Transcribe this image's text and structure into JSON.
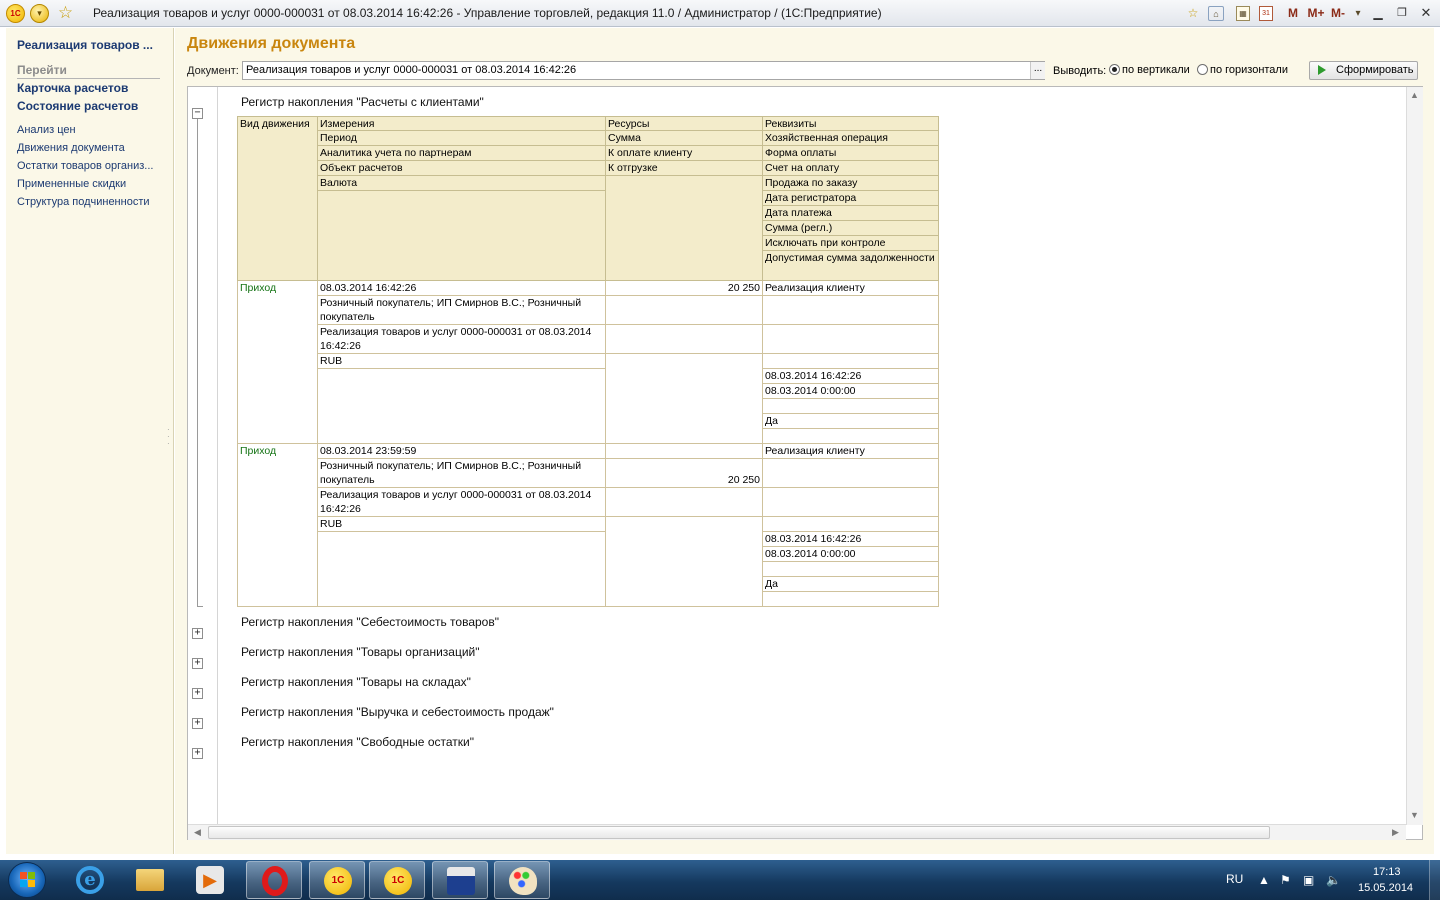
{
  "window": {
    "title": "Реализация товаров и услуг 0000-000031 от 08.03.2014 16:42:26 - Управление торговлей, редакция 11.0 / Администратор /  (1С:Предприятие)",
    "logo": "1С",
    "m_labels": [
      "M",
      "M+",
      "M-"
    ]
  },
  "sidebar": {
    "title": "Реализация товаров ...",
    "goto_label": "Перейти",
    "primary_links": [
      "Карточка расчетов",
      "Состояние расчетов"
    ],
    "links": [
      "Анализ цен",
      "Движения документа",
      "Остатки товаров организ...",
      "Примененные скидки",
      "Структура подчиненности"
    ]
  },
  "main": {
    "title": "Движения документа",
    "document_label": "Документ:",
    "document_value": "Реализация товаров и услуг 0000-000031 от 08.03.2014 16:42:26",
    "document_select": "...",
    "output_label": "Выводить:",
    "output_options": [
      {
        "label": "по вертикали",
        "selected": true
      },
      {
        "label": "по горизонтали",
        "selected": false
      }
    ],
    "run_button": "Сформировать"
  },
  "report": {
    "expanded_register": "Регистр накопления \"Расчеты с клиентами\"",
    "table": {
      "col_kind": "Вид движения",
      "col_dims": "Измерения",
      "col_res": "Ресурсы",
      "col_props": "Реквизиты",
      "dims": [
        "Период",
        "Аналитика учета по партнерам",
        "Объект расчетов",
        "Валюта"
      ],
      "res": [
        "Сумма",
        "К оплате клиенту",
        "К отгрузке"
      ],
      "props": [
        "Хозяйственная операция",
        "Форма оплаты",
        "Счет на оплату",
        "Продажа по заказу",
        "Дата регистратора",
        "Дата платежа",
        "Сумма (регл.)",
        "Исключать при контроле",
        "Допустимая сумма задолженности"
      ]
    },
    "records": [
      {
        "kind": "Приход",
        "period": "08.03.2014 16:42:26",
        "partner": "Розничный покупатель; ИП Смирнов В.С.; Розничный покупатель",
        "object": "Реализация товаров и услуг 0000-000031 от 08.03.2014 16:42:26",
        "currency": "RUB",
        "amount": "20 250",
        "to_pay": "",
        "to_ship": "",
        "operation": "Реализация клиенту",
        "reg_date": "08.03.2014 16:42:26",
        "pay_date": "08.03.2014 0:00:00",
        "exclude": "Да"
      },
      {
        "kind": "Приход",
        "period": "08.03.2014 23:59:59",
        "partner": "Розничный покупатель; ИП Смирнов В.С.; Розничный покупатель",
        "object": "Реализация товаров и услуг 0000-000031 от 08.03.2014 16:42:26",
        "currency": "RUB",
        "amount": "",
        "to_pay": "20 250",
        "to_ship": "",
        "operation": "Реализация клиенту",
        "reg_date": "08.03.2014 16:42:26",
        "pay_date": "08.03.2014 0:00:00",
        "exclude": "Да"
      }
    ],
    "collapsed_registers": [
      "Регистр накопления \"Себестоимость товаров\"",
      "Регистр накопления \"Товары организаций\"",
      "Регистр накопления \"Товары на складах\"",
      "Регистр накопления \"Выручка и себестоимость продаж\"",
      "Регистр накопления \"Свободные остатки\""
    ],
    "toggle_minus": "−",
    "toggle_plus": "+"
  },
  "taskbar": {
    "apps": [
      "internet-explorer-icon",
      "file-manager-icon",
      "media-player-icon",
      "opera-icon",
      "1c-configurator-icon",
      "1c-enterprise-icon",
      "save-disk-icon",
      "paint-icon"
    ],
    "language": "RU",
    "time": "17:13",
    "date": "15.05.2014"
  },
  "colors": {
    "accent_title": "#c9860f",
    "nav_link": "#1c3a72",
    "header_fill": "#f3eccb",
    "movement_kind": "#147314"
  }
}
